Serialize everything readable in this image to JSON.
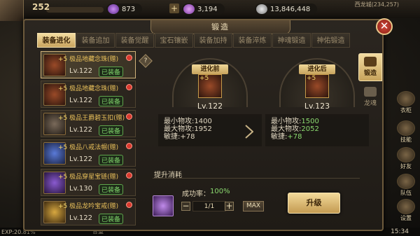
{
  "hud": {
    "level": "252",
    "currency_1": "873",
    "currency_2": "3,194",
    "currency_3": "13,846,448",
    "server": "西龙城(234,257)",
    "exp": "EXP:20.81%",
    "chat_label": "昔重",
    "clock": "15:34"
  },
  "side_menu": [
    "衣柜",
    "技能",
    "好友",
    "队伍",
    "设置"
  ],
  "panel": {
    "title": "锻造",
    "close_label": "✕"
  },
  "tabs": [
    {
      "label": "装备进化",
      "active": true
    },
    {
      "label": "装备追加",
      "active": false
    },
    {
      "label": "装备觉醒",
      "active": false
    },
    {
      "label": "宝石镶嵌",
      "active": false
    },
    {
      "label": "装备加持",
      "active": false
    },
    {
      "label": "装备淬炼",
      "active": false
    },
    {
      "label": "神魂锻造",
      "active": false
    },
    {
      "label": "神佑锻造",
      "active": false
    }
  ],
  "vertical_tabs": [
    {
      "label": "锻造",
      "active": true
    },
    {
      "label": "龙魂",
      "active": false
    }
  ],
  "items": [
    {
      "plus": "+5",
      "name": "极品地藏念珠(赠)",
      "level": "Lv.122",
      "equipped": "已装备",
      "icon": "red"
    },
    {
      "plus": "+5",
      "name": "极品地藏念珠(赠)",
      "level": "Lv.122",
      "equipped": "已装备",
      "icon": "red"
    },
    {
      "plus": "+5",
      "name": "极品王爵碧玉扣(赠)",
      "level": "Lv.122",
      "equipped": "已装备",
      "icon": "dark"
    },
    {
      "plus": "+5",
      "name": "极品八戒法帽(赠)",
      "level": "Lv.122",
      "equipped": "已装备",
      "icon": "blue"
    },
    {
      "plus": "+5",
      "name": "极品穿星宝链(赠)",
      "level": "Lv.130",
      "equipped": "已装备",
      "icon": "purple"
    },
    {
      "plus": "+5",
      "name": "极品龙吟宝戒(赠)",
      "level": "Lv.122",
      "equipped": "已装备",
      "icon": "gold"
    }
  ],
  "compare": {
    "before": {
      "label": "进化前",
      "plus": "+5",
      "level": "Lv.122",
      "min_atk_label": "最小物攻:",
      "min_atk": "1400",
      "max_atk_label": "最大物攻:",
      "max_atk": "1952",
      "agi_label": "敏捷:",
      "agi": "+78"
    },
    "after": {
      "label": "进化后",
      "plus": "+5",
      "level": "Lv.123",
      "min_atk_label": "最小物攻:",
      "min_atk": "1500",
      "max_atk_label": "最大物攻:",
      "max_atk": "2052",
      "agi_label": "敏捷:",
      "agi": "+78"
    }
  },
  "cost": {
    "title": "提升消耗",
    "success_label": "成功率：",
    "success_value": "100%",
    "quantity": "1/1",
    "minus_label": "−",
    "plus_label": "+",
    "max_label": "MAX",
    "upgrade_label": "升级",
    "help_label": "?"
  },
  "colors": {
    "accent_gold": "#c9a45e",
    "stat_increase": "#8bd96f",
    "item_name": "#e9c05a",
    "badge_red": "#d9392e"
  }
}
